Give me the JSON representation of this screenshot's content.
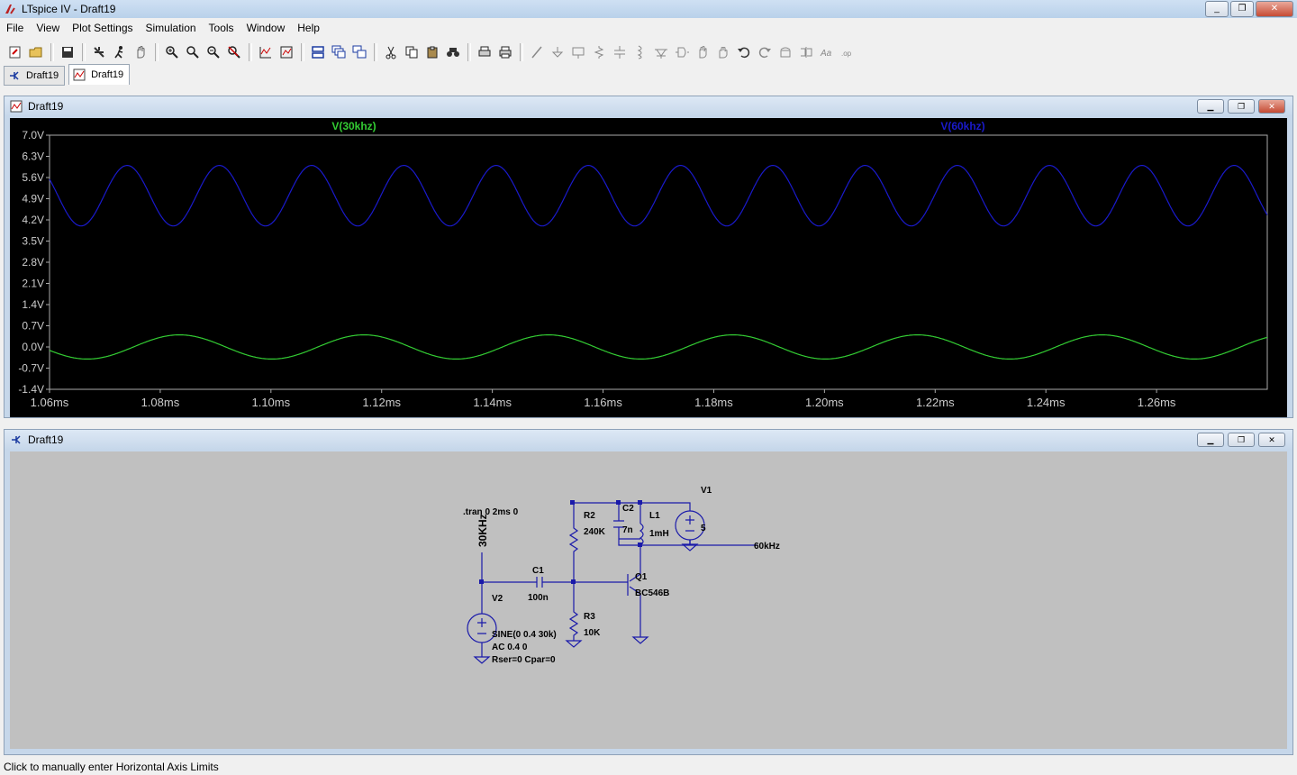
{
  "window": {
    "title": "LTspice IV - Draft19",
    "minimize": "_",
    "restore": "❐",
    "close": "✕"
  },
  "menu": [
    "File",
    "View",
    "Plot Settings",
    "Simulation",
    "Tools",
    "Window",
    "Help"
  ],
  "toolbar_icons": [
    "new-schematic-icon",
    "open-icon",
    "save-icon",
    "control-panel-icon",
    "run-icon",
    "halt-icon",
    "zoom-in-icon",
    "zoom-out-icon",
    "zoom-full-icon",
    "zoom-cancel-icon",
    "autorange-icon",
    "axis-icon",
    "tile-horizontal-icon",
    "cascade-icon",
    "tile-vertical-icon",
    "cut-icon",
    "copy-icon",
    "paste-icon",
    "find-icon",
    "print-setup-icon",
    "print-icon",
    "wire-icon",
    "ground-icon",
    "label-icon",
    "resistor-icon",
    "capacitor-icon",
    "inductor-icon",
    "diode-icon",
    "component-icon",
    "move-icon",
    "drag-icon",
    "undo-icon",
    "redo-icon",
    "rotate-icon",
    "mirror-icon",
    "text-icon",
    "spice-directive-icon"
  ],
  "tabs": [
    {
      "label": "Draft19",
      "kind": "schematic",
      "active": false
    },
    {
      "label": "Draft19",
      "kind": "waveform",
      "active": true
    }
  ],
  "plot_window": {
    "title": "Draft19"
  },
  "schematic_window": {
    "title": "Draft19"
  },
  "chart_data": {
    "type": "line",
    "xlabel": "",
    "ylabel": "",
    "x_ticks": [
      "1.06ms",
      "1.08ms",
      "1.10ms",
      "1.12ms",
      "1.14ms",
      "1.16ms",
      "1.18ms",
      "1.20ms",
      "1.22ms",
      "1.24ms",
      "1.26ms"
    ],
    "y_ticks": [
      "7.0V",
      "6.3V",
      "5.6V",
      "4.9V",
      "4.2V",
      "3.5V",
      "2.8V",
      "2.1V",
      "1.4V",
      "0.7V",
      "0.0V",
      "-0.7V",
      "-1.4V"
    ],
    "xlim": [
      1.06,
      1.28
    ],
    "ylim": [
      -1.4,
      7.0
    ],
    "grid": false,
    "series": [
      {
        "name": "V(30khz)",
        "color": "#33cc33",
        "offset": 0.0,
        "amplitude": 0.4,
        "frequency_khz": 30
      },
      {
        "name": "V(60khz)",
        "color": "#1a1acc",
        "offset": 5.0,
        "amplitude": 1.0,
        "frequency_khz": 60
      }
    ]
  },
  "schematic": {
    "directive": ".tran 0 2ms 0",
    "net_30": "30KHz",
    "net_60": "60kHz",
    "v1": {
      "name": "V1",
      "value": "5"
    },
    "v2": {
      "name": "V2",
      "line1": "SINE(0 0.4 30k)",
      "line2": "AC 0.4 0",
      "line3": "Rser=0 Cpar=0"
    },
    "c1": {
      "name": "C1",
      "value": "100n"
    },
    "c2": {
      "name": "C2",
      "value": "7n"
    },
    "l1": {
      "name": "L1",
      "value": "1mH"
    },
    "r2": {
      "name": "R2",
      "value": "240K"
    },
    "r3": {
      "name": "R3",
      "value": "10K"
    },
    "q1": {
      "name": "Q1",
      "value": "BC546B"
    }
  },
  "status": "Click to manually enter Horizontal Axis Limits"
}
